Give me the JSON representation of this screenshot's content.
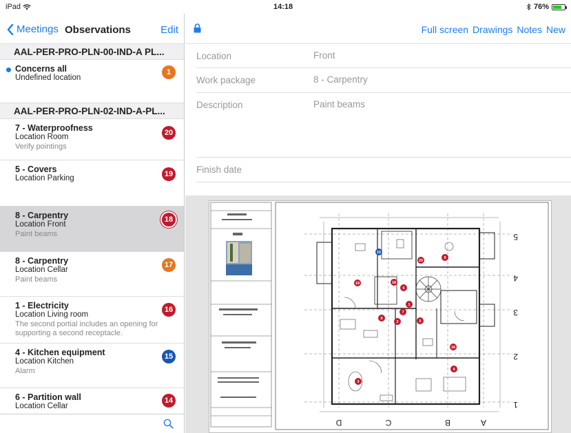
{
  "status": {
    "device": "iPad",
    "time": "14:18",
    "battery": "76%",
    "battery_level": 0.76
  },
  "master": {
    "back_label": "Meetings",
    "title": "Observations",
    "edit_label": "Edit",
    "sections": [
      {
        "title": "AAL-PER-PRO-PLN-00-IND-A PL...",
        "items": [
          {
            "title": "Concerns all",
            "subtitle": "Undefined location",
            "note": "",
            "badge": "1",
            "color": "#e8761e"
          }
        ]
      },
      {
        "title": "AAL-PER-PRO-PLN-02-IND-A-PL...",
        "items": [
          {
            "title": "7 - Waterproofness",
            "subtitle": "Location Room",
            "note": "Verify pointings",
            "badge": "20",
            "color": "#c21a2c"
          },
          {
            "title": "5 - Covers",
            "subtitle": "Location Parking",
            "note": "",
            "badge": "19",
            "color": "#c21a2c"
          },
          {
            "title": "8 - Carpentry",
            "subtitle": "Location Front",
            "note": "Paint beams",
            "badge": "18",
            "color": "#c21a2c"
          },
          {
            "title": "8 - Carpentry",
            "subtitle": "Location Cellar",
            "note": "Paint beams",
            "badge": "17",
            "color": "#e8761e"
          },
          {
            "title": "1 - Electricity",
            "subtitle": "Location Living room",
            "note": "The second portial includes an opening for supporting a second receptacle.",
            "badge": "16",
            "color": "#c21a2c"
          },
          {
            "title": "4 - Kitchen equipment",
            "subtitle": "Location Kitchen",
            "note": "Alarm",
            "badge": "15",
            "color": "#1a56b0"
          },
          {
            "title": "6 - Partition wall",
            "subtitle": "Location Cellar",
            "note": "",
            "badge": "14",
            "color": "#c21a2c"
          }
        ]
      }
    ]
  },
  "detail": {
    "actions": [
      "Full screen",
      "Drawings",
      "Notes",
      "New"
    ],
    "fields": {
      "location": {
        "label": "Location",
        "value": "Front"
      },
      "work_package": {
        "label": "Work package",
        "value": "8 - Carpentry"
      },
      "description": {
        "label": "Description",
        "value": "Paint beams"
      },
      "finish_date": {
        "label": "Finish date",
        "value": ""
      }
    }
  },
  "drawing": {
    "axis_numbers": [
      "5",
      "4",
      "3",
      "2",
      "1"
    ],
    "axis_letters": [
      "D",
      "C",
      "B",
      "A"
    ],
    "markers": [
      {
        "n": "10",
        "color": "#1a56b0"
      },
      {
        "n": "20",
        "color": "#c21a2c"
      },
      {
        "n": "18",
        "color": "#c21a2c"
      },
      {
        "n": "19",
        "color": "#c21a2c"
      },
      {
        "n": "16",
        "color": "#c21a2c"
      },
      {
        "n": "1",
        "color": "#c21a2c"
      },
      {
        "n": "7",
        "color": "#c21a2c"
      },
      {
        "n": "2",
        "color": "#c21a2c"
      },
      {
        "n": "8",
        "color": "#c21a2c"
      },
      {
        "n": "9",
        "color": "#c21a2c"
      },
      {
        "n": "3",
        "color": "#c21a2c"
      },
      {
        "n": "4",
        "color": "#c21a2c"
      },
      {
        "n": "5",
        "color": "#c21a2c"
      },
      {
        "n": "6",
        "color": "#c21a2c"
      }
    ]
  }
}
